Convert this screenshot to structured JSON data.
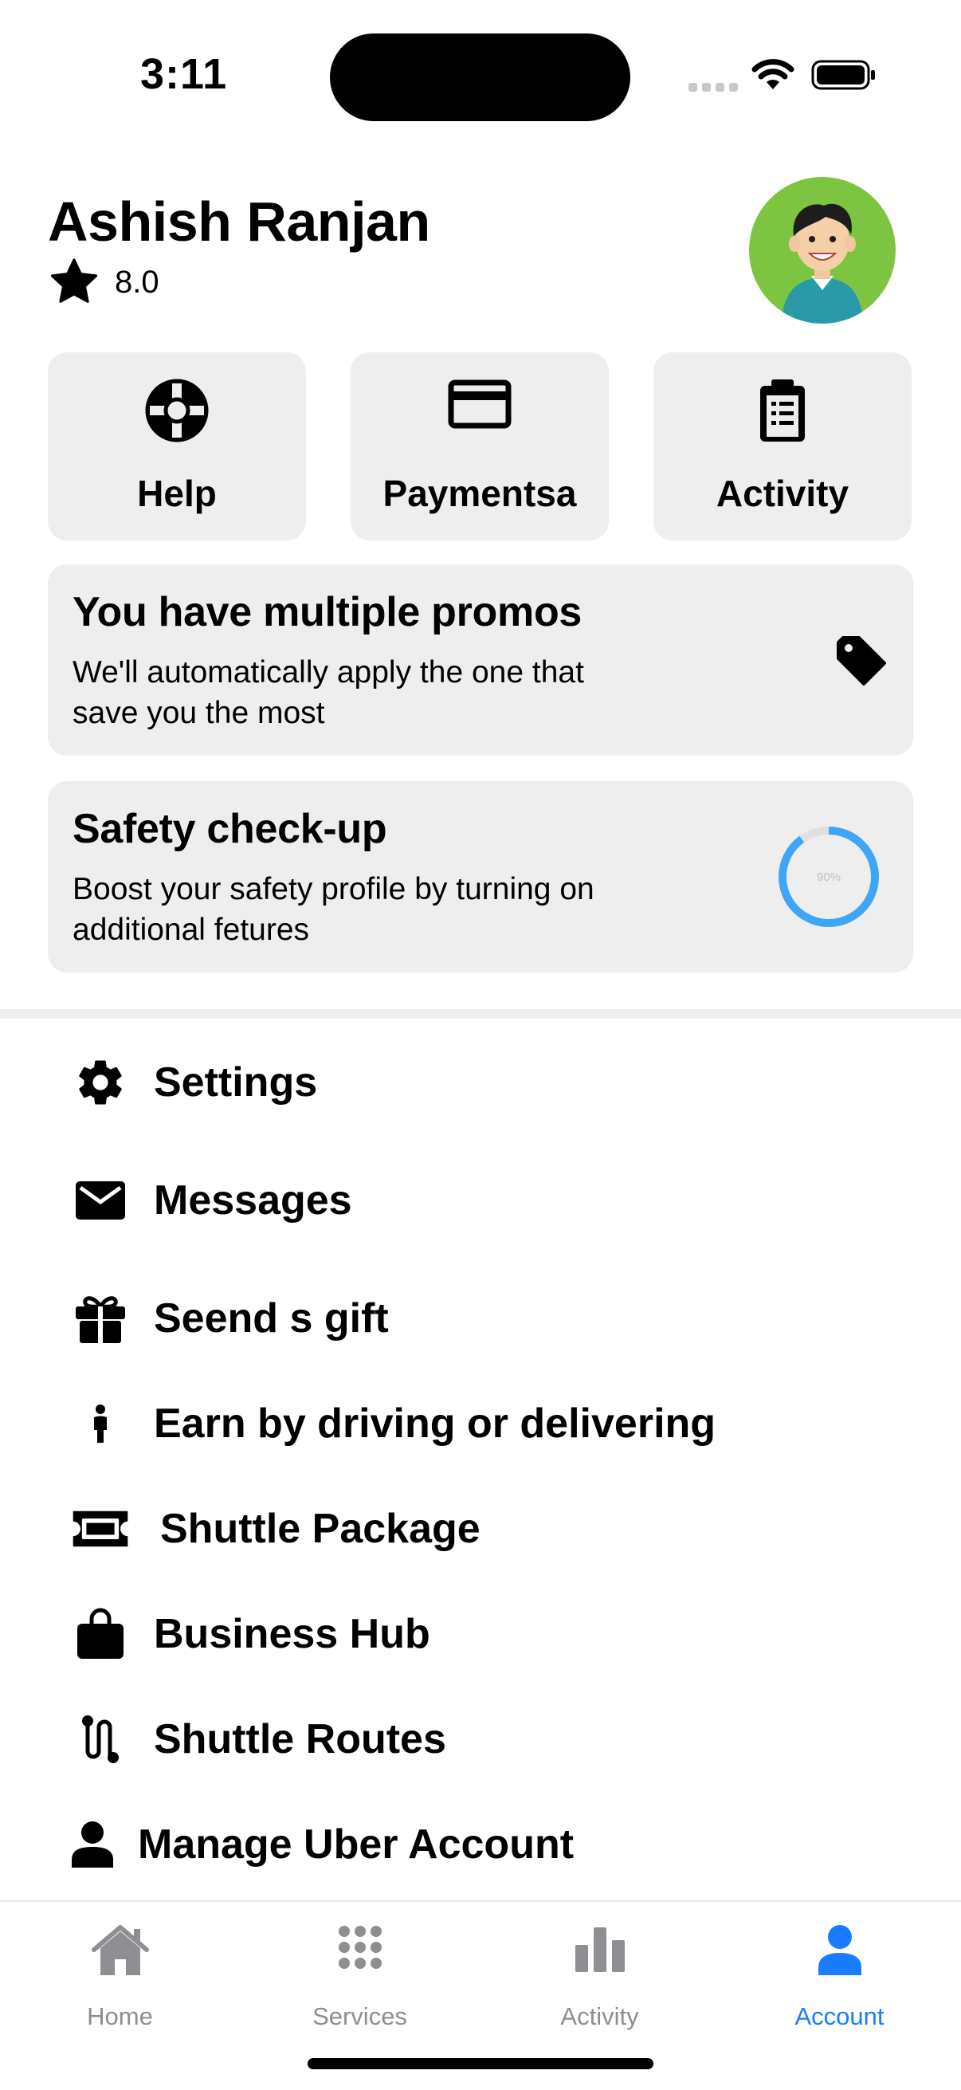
{
  "status_bar": {
    "time": "3:11"
  },
  "header": {
    "user_name": "Ashish Ranjan",
    "rating": "8.0",
    "avatar_icon": "user-avatar-cartoon"
  },
  "tiles": [
    {
      "label": "Help",
      "icon": "lifebuoy-icon"
    },
    {
      "label": "Paymentsa",
      "icon": "credit-card-icon"
    },
    {
      "label": "Activity",
      "icon": "clipboard-icon"
    }
  ],
  "promo_card": {
    "title": "You have multiple promos",
    "description": "We'll automatically apply the one that save you the most",
    "icon": "tag-icon"
  },
  "safety_card": {
    "title": "Safety check-up",
    "description": "Boost your safety profile by turning on additional fetures",
    "progress_label": "90%",
    "progress": 0.9
  },
  "menu": [
    {
      "label": "Settings",
      "icon": "gear-icon"
    },
    {
      "label": "Messages",
      "icon": "envelope-icon"
    },
    {
      "label": "Seend s gift",
      "icon": "gift-icon"
    },
    {
      "label": "Earn by driving or delivering",
      "icon": "person-icon"
    },
    {
      "label": "Shuttle Package",
      "icon": "ticket-icon"
    },
    {
      "label": "Business Hub",
      "icon": "briefcase-icon"
    },
    {
      "label": "Shuttle Routes",
      "icon": "route-icon"
    },
    {
      "label": "Manage Uber Account",
      "icon": "account-icon"
    }
  ],
  "tab_bar": {
    "tabs": [
      {
        "label": "Home",
        "icon": "house-icon",
        "active": false
      },
      {
        "label": "Services",
        "icon": "grid-dots-icon",
        "active": false
      },
      {
        "label": "Activity",
        "icon": "bar-chart-icon",
        "active": false
      },
      {
        "label": "Account",
        "icon": "person-circle-icon",
        "active": true
      }
    ]
  },
  "colors": {
    "accent": "#1a7cff",
    "card_bg": "#eeeeee",
    "progress_ring": "#3ea6f5",
    "avatar_bg": "#7dc540",
    "inactive_tab": "#8e8e93"
  }
}
